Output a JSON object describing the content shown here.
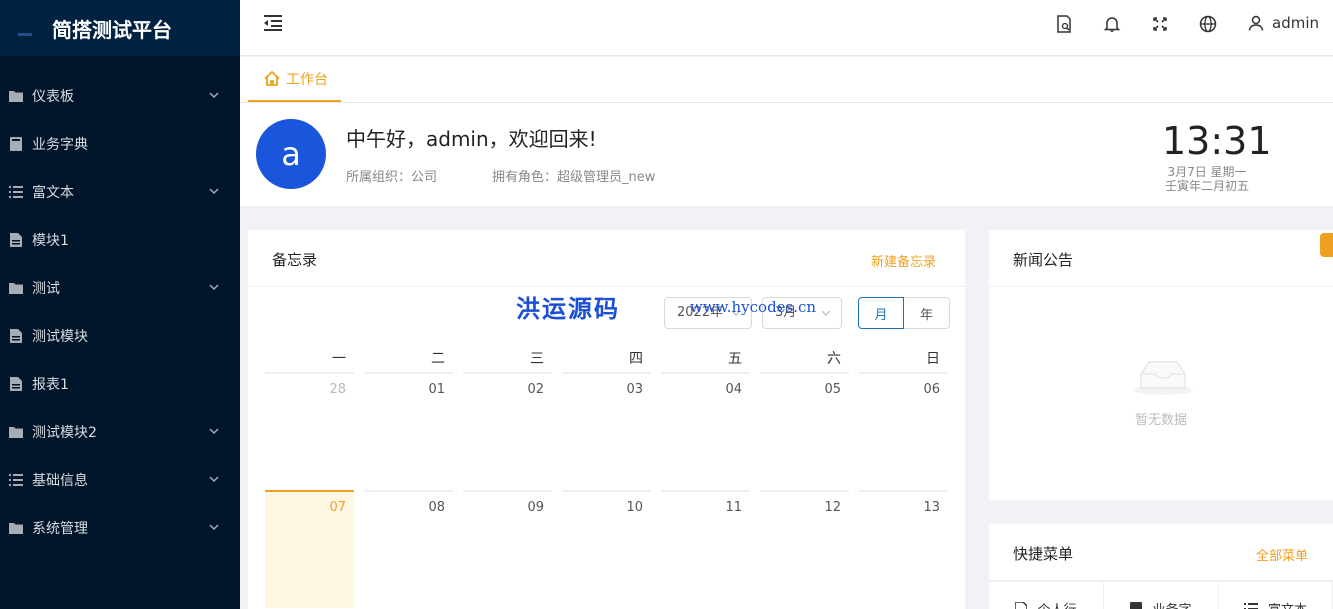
{
  "app": {
    "title": "简搭测试平台"
  },
  "sidebar": {
    "items": [
      {
        "label": "仪表板",
        "icon": "folder-icon",
        "has_children": true
      },
      {
        "label": "业务字典",
        "icon": "book-icon",
        "has_children": false
      },
      {
        "label": "富文本",
        "icon": "list-icon",
        "has_children": true
      },
      {
        "label": "模块1",
        "icon": "file-icon",
        "has_children": false
      },
      {
        "label": "测试",
        "icon": "folder-icon",
        "has_children": true
      },
      {
        "label": "测试模块",
        "icon": "file-icon",
        "has_children": false
      },
      {
        "label": "报表1",
        "icon": "file-icon",
        "has_children": false
      },
      {
        "label": "测试模块2",
        "icon": "folder-icon",
        "has_children": true
      },
      {
        "label": "基础信息",
        "icon": "list-icon",
        "has_children": true
      },
      {
        "label": "系统管理",
        "icon": "folder-icon",
        "has_children": true
      }
    ]
  },
  "header": {
    "username": "admin"
  },
  "tabs": [
    {
      "label": "工作台",
      "icon": "home-icon",
      "active": true
    }
  ],
  "welcome": {
    "avatar_letter": "a",
    "greeting": "中午好，admin，欢迎回来!",
    "org": "所属组织：公司",
    "role": "拥有角色：超级管理员_new",
    "time": "13:31",
    "date": "3月7日 星期一",
    "lunar": "壬寅年二月初五"
  },
  "memo": {
    "title": "备忘录",
    "new_label": "新建备忘录",
    "watermark": "洪运源码",
    "watermark_url": "www.hycodes.cn",
    "year_select": "2022年",
    "month_select": "3月",
    "mode_month": "月",
    "mode_year": "年",
    "weekdays": [
      "一",
      "二",
      "三",
      "四",
      "五",
      "六",
      "日"
    ],
    "rows": [
      [
        "28",
        "01",
        "02",
        "03",
        "04",
        "05",
        "06"
      ],
      [
        "07",
        "08",
        "09",
        "10",
        "11",
        "12",
        "13"
      ]
    ],
    "today": "07"
  },
  "news": {
    "title": "新闻公告",
    "empty": "暂无数据"
  },
  "quick": {
    "title": "快捷菜单",
    "all_label": "全部菜单",
    "items": [
      "个人行",
      "业务字",
      "富文本"
    ]
  },
  "colors": {
    "accent": "#f0a020",
    "sidebar": "#001529",
    "primary": "#1a73b8"
  }
}
